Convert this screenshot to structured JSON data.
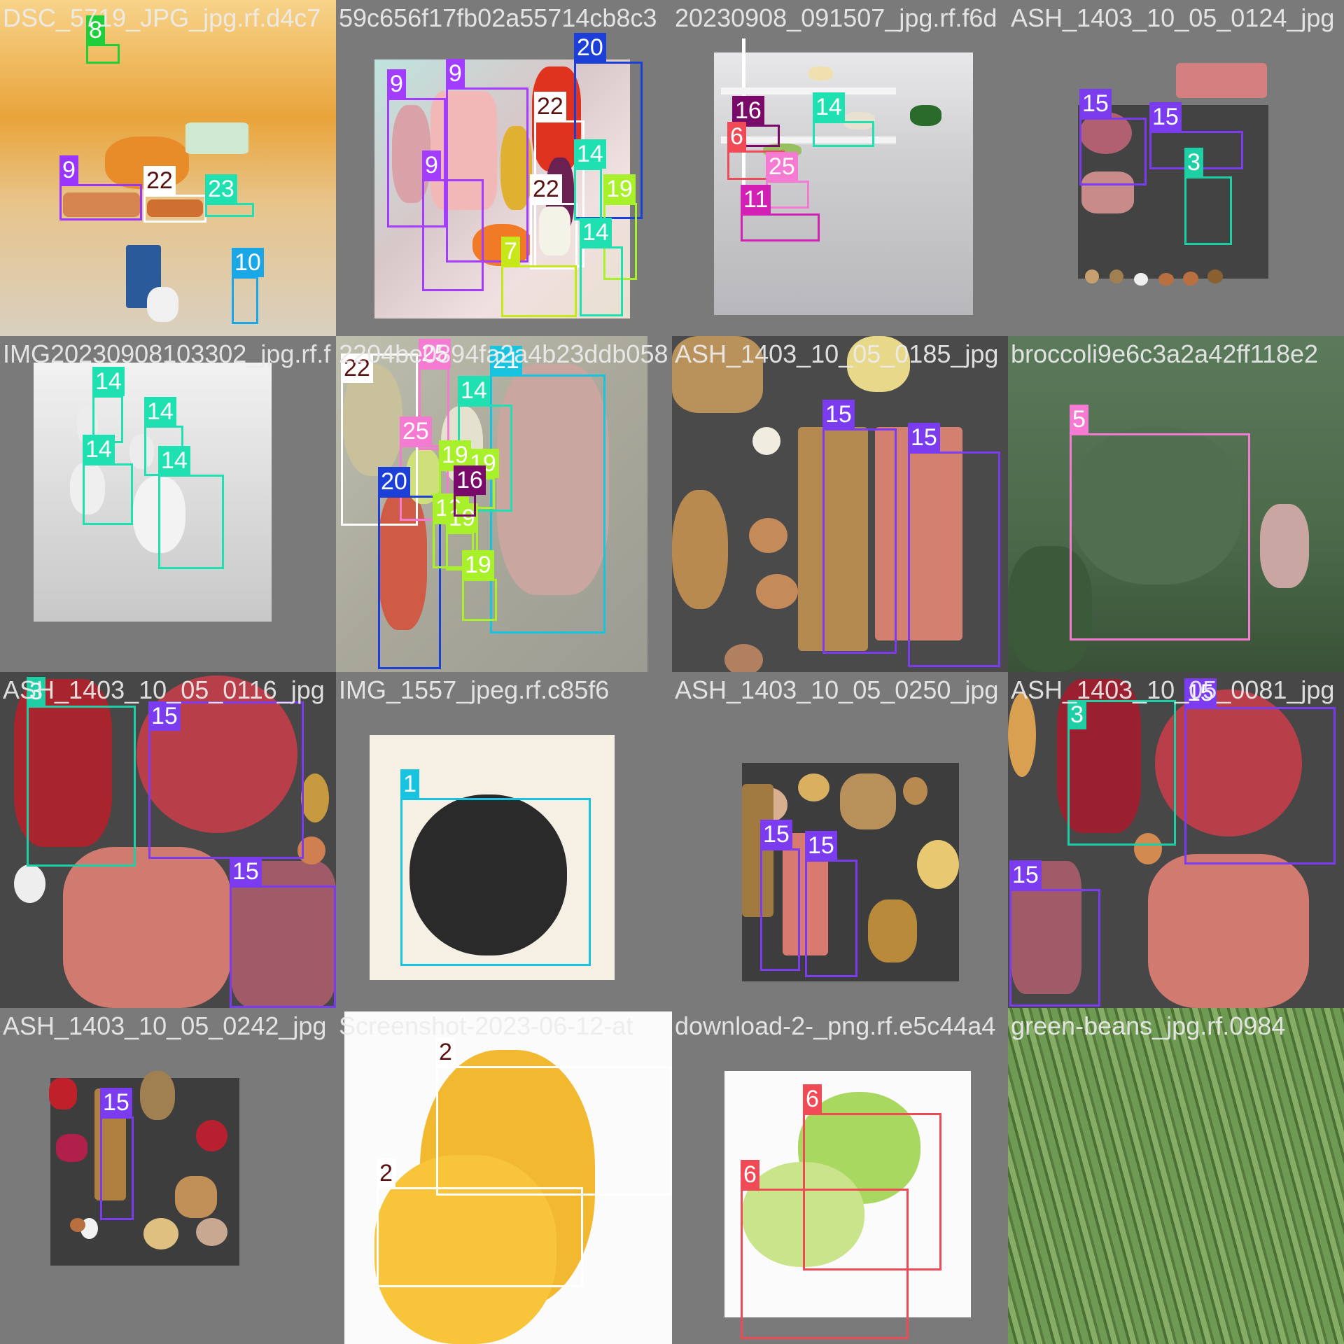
{
  "tiles": [
    {
      "id": "t1",
      "title": "DSC_5719_JPG_jpg.rf.d4c7",
      "boxes": [
        {
          "label": "8",
          "color": "#1fcf3a"
        },
        {
          "label": "9",
          "color": "#9a35ff"
        },
        {
          "label": "22",
          "color": "#ffffff",
          "dark": true
        },
        {
          "label": "23",
          "color": "#1ee0b0"
        },
        {
          "label": "10",
          "color": "#1aa7e6"
        }
      ]
    },
    {
      "id": "t2",
      "title": "59c656f17fb02a55714cb8c3",
      "boxes": [
        {
          "label": "9",
          "color": "#a23cff"
        },
        {
          "label": "9",
          "color": "#a23cff"
        },
        {
          "label": "9",
          "color": "#a23cff"
        },
        {
          "label": "22",
          "color": "#ffffff",
          "dark": true
        },
        {
          "label": "22",
          "color": "#ffffff",
          "dark": true
        },
        {
          "label": "20",
          "color": "#1c3fd8"
        },
        {
          "label": "14",
          "color": "#1ee0b0"
        },
        {
          "label": "19",
          "color": "#a8f02a"
        },
        {
          "label": "7",
          "color": "#c6e81a"
        },
        {
          "label": "14",
          "color": "#1ee0b0"
        }
      ]
    },
    {
      "id": "t3",
      "title": "20230908_091507_jpg.rf.f6d",
      "boxes": [
        {
          "label": "16",
          "color": "#7a0a6a"
        },
        {
          "label": "14",
          "color": "#1ee0b0"
        },
        {
          "label": "6",
          "color": "#ef4a55"
        },
        {
          "label": "25",
          "color": "#f57ad2"
        },
        {
          "label": "11",
          "color": "#d21fb4"
        }
      ]
    },
    {
      "id": "t4",
      "title": "ASH_1403_10_05_0124_jpg",
      "boxes": [
        {
          "label": "15",
          "color": "#7b3cf0"
        },
        {
          "label": "15",
          "color": "#7b3cf0"
        },
        {
          "label": "3",
          "color": "#1ecfa6"
        }
      ]
    },
    {
      "id": "t5",
      "title": "IMG20230908103302_jpg.rf.f",
      "boxes": [
        {
          "label": "14",
          "color": "#1ee0b0"
        },
        {
          "label": "14",
          "color": "#1ee0b0"
        },
        {
          "label": "14",
          "color": "#1ee0b0"
        },
        {
          "label": "14",
          "color": "#1ee0b0"
        }
      ]
    },
    {
      "id": "t6",
      "title": "2204be0894fa2a4b23ddb058",
      "boxes": [
        {
          "label": "22",
          "color": "#ffffff",
          "dark": true
        },
        {
          "label": "25",
          "color": "#f57ad2"
        },
        {
          "label": "21",
          "color": "#18c3e0"
        },
        {
          "label": "14",
          "color": "#1ee0b0"
        },
        {
          "label": "25",
          "color": "#f57ad2"
        },
        {
          "label": "20",
          "color": "#1c3fd8"
        },
        {
          "label": "19",
          "color": "#a8f02a"
        },
        {
          "label": "19",
          "color": "#a8f02a"
        },
        {
          "label": "19",
          "color": "#a8f02a"
        },
        {
          "label": "19",
          "color": "#a8f02a"
        },
        {
          "label": "16",
          "color": "#7a0a6a"
        },
        {
          "label": "19",
          "color": "#a8f02a"
        }
      ]
    },
    {
      "id": "t7",
      "title": "ASH_1403_10_05_0185_jpg",
      "boxes": [
        {
          "label": "15",
          "color": "#7b3cf0"
        },
        {
          "label": "15",
          "color": "#7b3cf0"
        }
      ]
    },
    {
      "id": "t8",
      "title": "broccoli9e6c3a2a42ff118e2",
      "boxes": [
        {
          "label": "5",
          "color": "#f57ad2"
        }
      ]
    },
    {
      "id": "t9",
      "title": "ASH_1403_10_05_0116_jpg",
      "boxes": [
        {
          "label": "3",
          "color": "#1ecfa6"
        },
        {
          "label": "15",
          "color": "#7b3cf0"
        },
        {
          "label": "15",
          "color": "#7b3cf0"
        }
      ]
    },
    {
      "id": "t10",
      "title": "IMG_1557_jpeg.rf.c85f6",
      "boxes": [
        {
          "label": "1",
          "color": "#18c3e0"
        }
      ]
    },
    {
      "id": "t11",
      "title": "ASH_1403_10_05_0250_jpg",
      "boxes": [
        {
          "label": "15",
          "color": "#7b3cf0"
        },
        {
          "label": "15",
          "color": "#7b3cf0"
        }
      ]
    },
    {
      "id": "t12",
      "title": "ASH_1403_10_05_0081_jpg",
      "boxes": [
        {
          "label": "3",
          "color": "#1ecfa6"
        },
        {
          "label": "15",
          "color": "#7b3cf0"
        },
        {
          "label": "15",
          "color": "#7b3cf0"
        }
      ]
    },
    {
      "id": "t13",
      "title": "ASH_1403_10_05_0242_jpg",
      "boxes": [
        {
          "label": "15",
          "color": "#7b3cf0"
        }
      ]
    },
    {
      "id": "t14",
      "title": "Screenshot-2023-06-12-at",
      "boxes": [
        {
          "label": "2",
          "color": "#ffffff",
          "dark": true
        },
        {
          "label": "2",
          "color": "#ffffff",
          "dark": true
        }
      ]
    },
    {
      "id": "t15",
      "title": "download-2-_png.rf.e5c44a4",
      "boxes": [
        {
          "label": "6",
          "color": "#ef4a55"
        },
        {
          "label": "6",
          "color": "#ef4a55"
        }
      ]
    },
    {
      "id": "t16",
      "title": "green-beans_jpg.rf.0984",
      "boxes": []
    }
  ]
}
